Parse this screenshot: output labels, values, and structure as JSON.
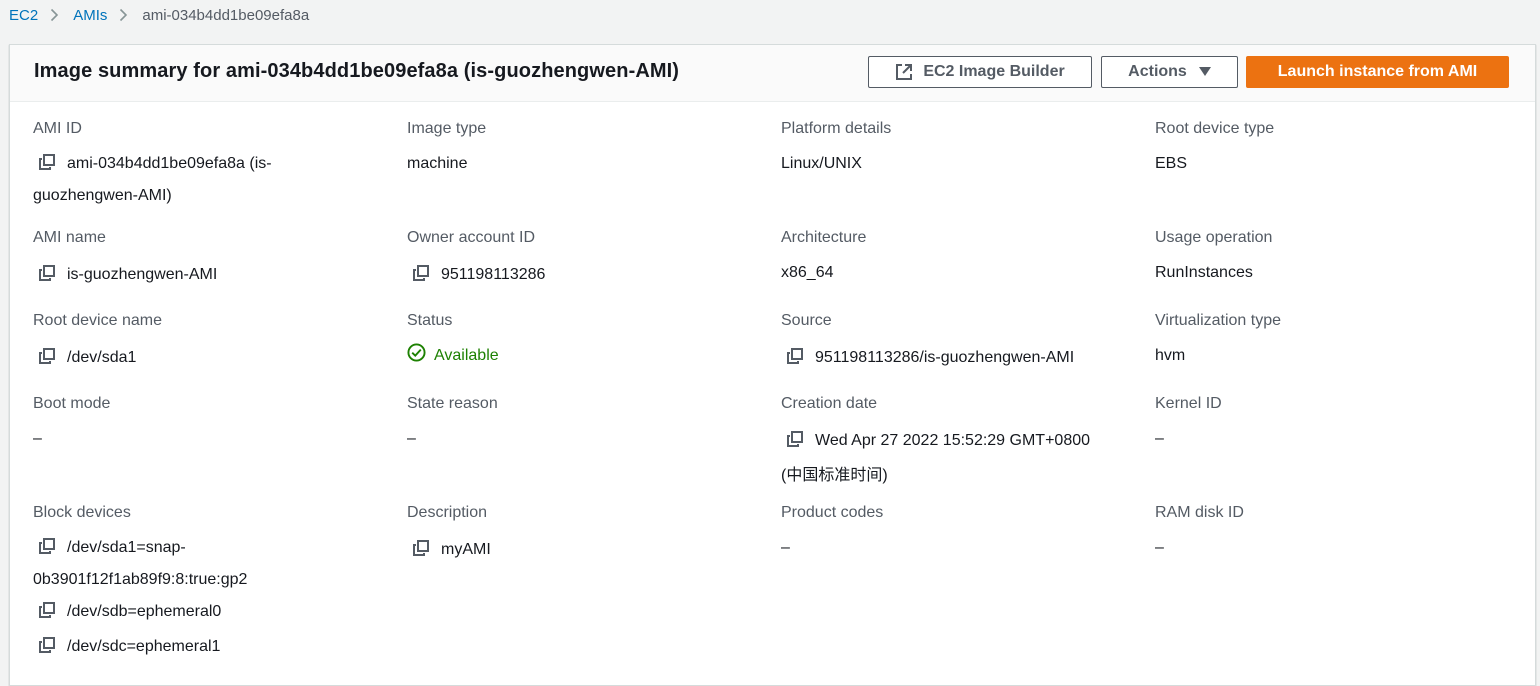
{
  "breadcrumb": {
    "items": [
      "EC2",
      "AMIs"
    ],
    "current": "ami-034b4dd1be09efa8a"
  },
  "header": {
    "title": "Image summary for ami-034b4dd1be09efa8a (is-guozhengwen-AMI)",
    "buttons": {
      "image_builder": "EC2 Image Builder",
      "actions": "Actions",
      "launch": "Launch instance from AMI"
    }
  },
  "colors": {
    "link": "#0073bb",
    "primary_button": "#ec7211",
    "status_available": "#1d8102"
  },
  "icons": {
    "copy": "copy-icon",
    "external": "external-link-icon",
    "caret": "caret-down-icon",
    "status": "check-circle-icon"
  },
  "fields": {
    "ami_id": {
      "label": "AMI ID",
      "value_line1": "ami-034b4dd1be09efa8a (is-",
      "value_line2": "guozhengwen-AMI)"
    },
    "image_type": {
      "label": "Image type",
      "value": "machine"
    },
    "platform_details": {
      "label": "Platform details",
      "value": "Linux/UNIX"
    },
    "root_device_type": {
      "label": "Root device type",
      "value": "EBS"
    },
    "ami_name": {
      "label": "AMI name",
      "value": "is-guozhengwen-AMI"
    },
    "owner_account_id": {
      "label": "Owner account ID",
      "value": "951198113286"
    },
    "architecture": {
      "label": "Architecture",
      "value": "x86_64"
    },
    "usage_operation": {
      "label": "Usage operation",
      "value": "RunInstances"
    },
    "root_device_name": {
      "label": "Root device name",
      "value": "/dev/sda1"
    },
    "status": {
      "label": "Status",
      "value": "Available"
    },
    "source": {
      "label": "Source",
      "value": "951198113286/is-guozhengwen-AMI"
    },
    "virtualization_type": {
      "label": "Virtualization type",
      "value": "hvm"
    },
    "boot_mode": {
      "label": "Boot mode",
      "value": "–"
    },
    "state_reason": {
      "label": "State reason",
      "value": "–"
    },
    "creation_date": {
      "label": "Creation date",
      "value_line1": "Wed Apr 27 2022 15:52:29 GMT+0800",
      "value_line2": "(中国标准时间)"
    },
    "kernel_id": {
      "label": "Kernel ID",
      "value": "–"
    },
    "block_devices": {
      "label": "Block devices",
      "items": [
        {
          "line1": "/dev/sda1=snap-",
          "line2": "0b3901f12f1ab89f9:8:true:gp2"
        },
        {
          "line1": "/dev/sdb=ephemeral0"
        },
        {
          "line1": "/dev/sdc=ephemeral1"
        }
      ]
    },
    "description": {
      "label": "Description",
      "value": "myAMI"
    },
    "product_codes": {
      "label": "Product codes",
      "value": "–"
    },
    "ram_disk_id": {
      "label": "RAM disk ID",
      "value": "–"
    }
  }
}
